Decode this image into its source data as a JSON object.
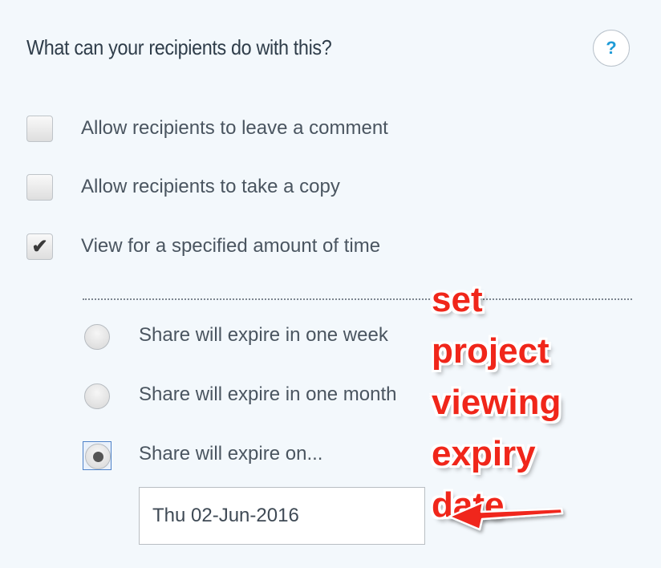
{
  "section": {
    "title": "What can your recipients do with this?",
    "help_label": "?"
  },
  "options": [
    {
      "label": "Allow recipients to leave a comment",
      "checked": false
    },
    {
      "label": "Allow recipients to take a copy",
      "checked": false
    },
    {
      "label": "View for a specified amount of time",
      "checked": true
    }
  ],
  "expiry": {
    "choices": [
      {
        "label": "Share will expire in one week",
        "selected": false
      },
      {
        "label": "Share will expire in one month",
        "selected": false
      },
      {
        "label": "Share will expire on...",
        "selected": true
      }
    ],
    "date_value": "Thu 02-Jun-2016"
  },
  "annotation": {
    "lines": [
      "set",
      "project",
      "viewing",
      "expiry",
      "date"
    ],
    "color": "#f0261a"
  },
  "colors": {
    "accent": "#1f9bd7",
    "background": "#f3f8fc",
    "selected_outline": "#4f83c9"
  }
}
